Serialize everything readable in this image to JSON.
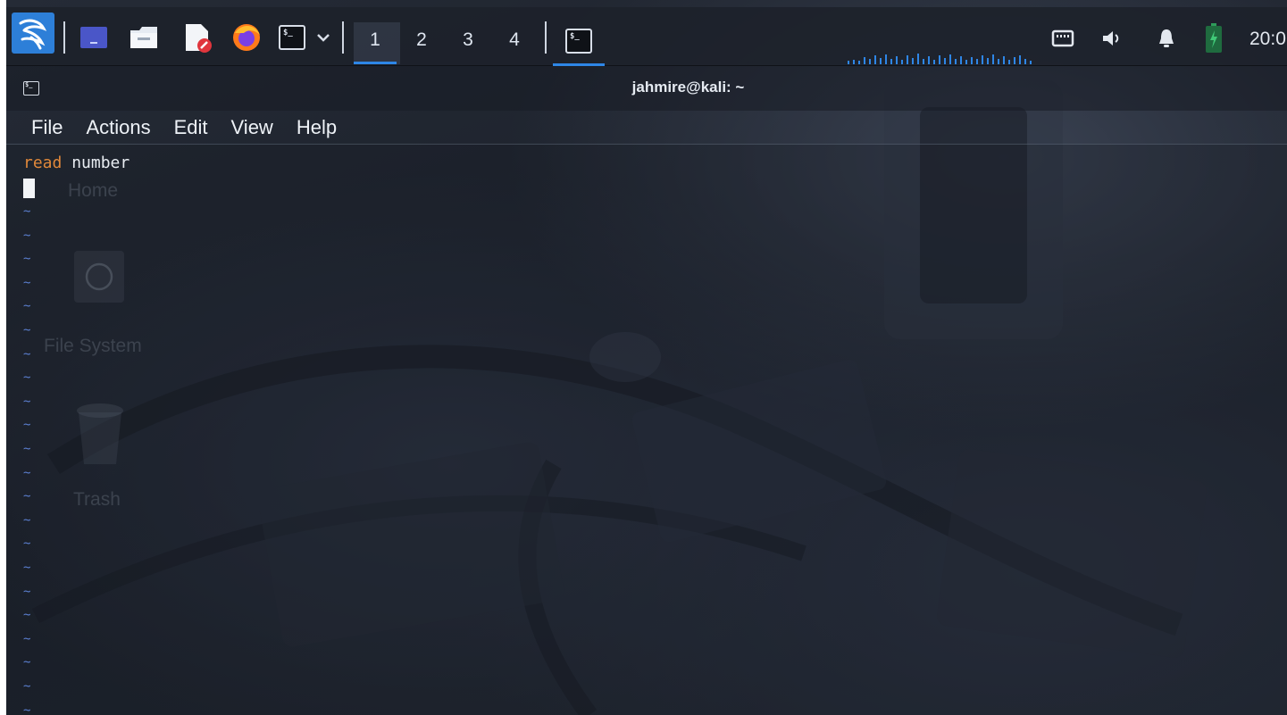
{
  "panel": {
    "workspaces": [
      "1",
      "2",
      "3",
      "4"
    ],
    "active_workspace": "1",
    "clock": "20:0",
    "icons": [
      "kali-menu-icon",
      "show-desktop-icon",
      "file-manager-icon",
      "text-editor-icon",
      "firefox-icon",
      "terminal-icon",
      "terminal-dropdown-icon",
      "terminal-task-icon",
      "network-icon",
      "volume-icon",
      "notifications-icon",
      "battery-icon"
    ]
  },
  "desktop": {
    "icons": [
      {
        "label": "Home"
      },
      {
        "label": "File System"
      },
      {
        "label": "Trash"
      }
    ]
  },
  "window": {
    "title": "jahmire@kali: ~",
    "menu": [
      "File",
      "Actions",
      "Edit",
      "View",
      "Help"
    ]
  },
  "editor": {
    "line1_keyword": "read",
    "line1_rest": " number",
    "empty_marker": "~"
  },
  "colors": {
    "keyword": "#e0883a",
    "tilde": "#5b7fd0",
    "active_accent": "#2e86e6",
    "battery": "#2e9c5a"
  }
}
